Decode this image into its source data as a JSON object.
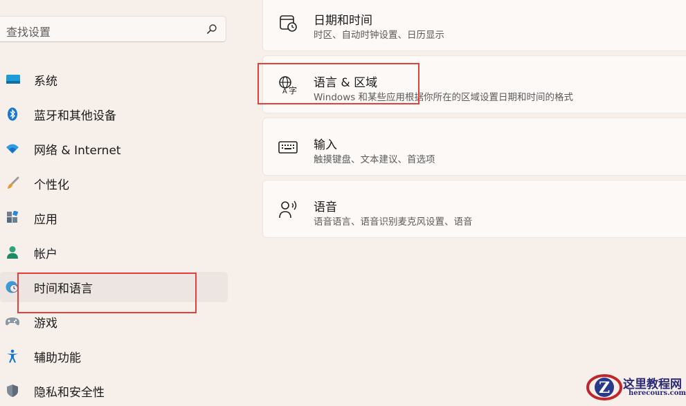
{
  "search": {
    "placeholder": "查找设置"
  },
  "sidebar": {
    "items": [
      {
        "label": "系统"
      },
      {
        "label": "蓝牙和其他设备"
      },
      {
        "label": "网络 & Internet"
      },
      {
        "label": "个性化"
      },
      {
        "label": "应用"
      },
      {
        "label": "帐户"
      },
      {
        "label": "时间和语言"
      },
      {
        "label": "游戏"
      },
      {
        "label": "辅助功能"
      },
      {
        "label": "隐私和安全性"
      }
    ]
  },
  "cards": [
    {
      "title": "日期和时间",
      "subtitle": "时区、自动时钟设置、日历显示"
    },
    {
      "title": "语言 & 区域",
      "subtitle": "Windows 和某些应用根据你所在的区域设置日期和时间的格式"
    },
    {
      "title": "输入",
      "subtitle": "触摸键盘、文本建议、首选项"
    },
    {
      "title": "语音",
      "subtitle": "语音语言、语音识别麦克风设置、语音"
    }
  ],
  "watermark": {
    "title": "这里教程网",
    "url": "herecours.com",
    "logo_letter": "Z"
  },
  "colors": {
    "highlight": "#e0413a",
    "accent": "#0067c0"
  }
}
